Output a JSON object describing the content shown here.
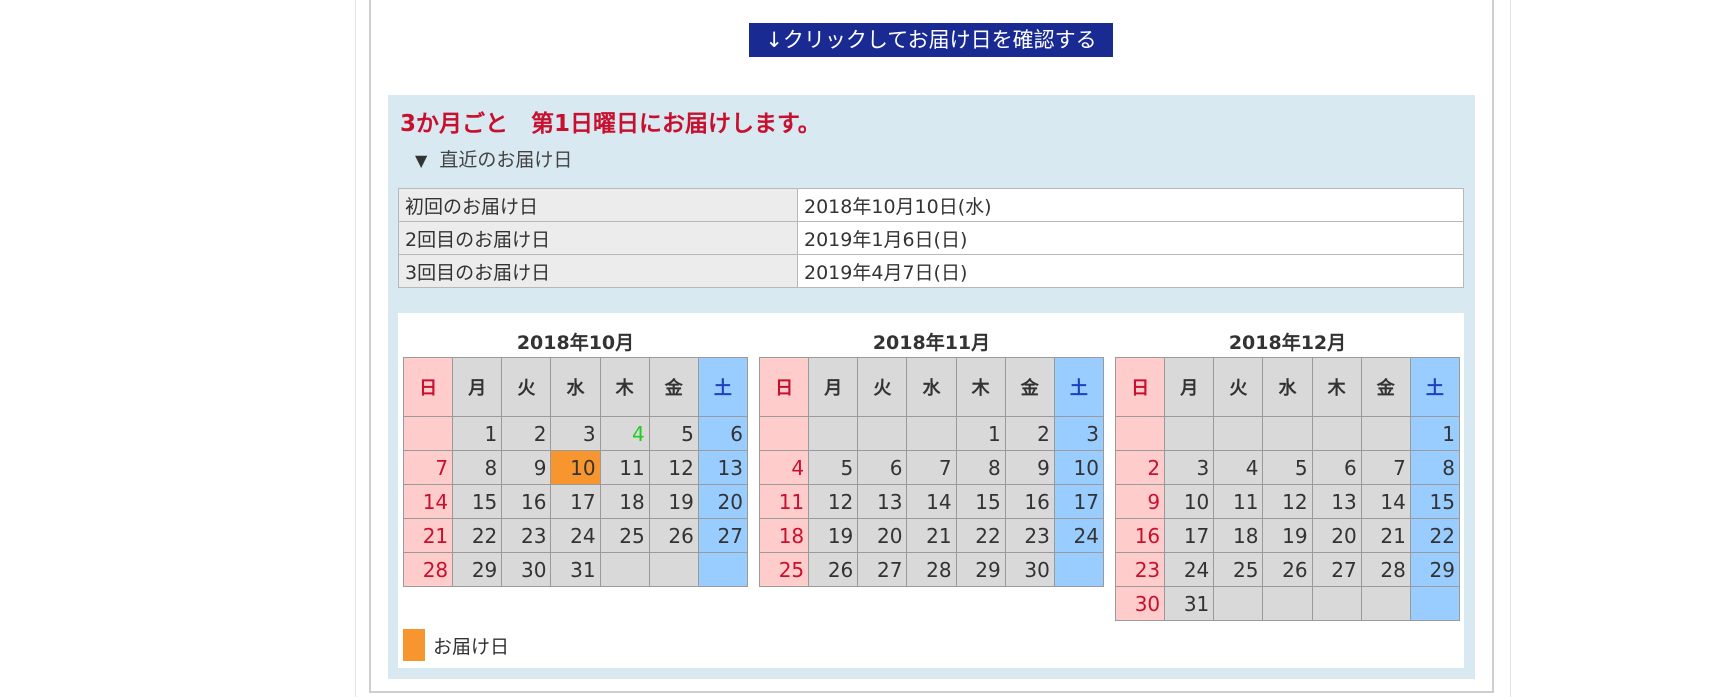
{
  "confirm_button": "↓クリックしてお届け日を確認する",
  "panel": {
    "title": "3か月ごと　第1日曜日にお届けします。",
    "section_toggle_icon": "▼",
    "section_label": "直近のお届け日"
  },
  "deliveries": [
    {
      "label": "初回のお届け日",
      "date": "2018年10月10日(水)"
    },
    {
      "label": "2回目のお届け日",
      "date": "2019年1月6日(日)"
    },
    {
      "label": "3回目のお届け日",
      "date": "2019年4月7日(日)"
    }
  ],
  "weekdays": [
    "日",
    "月",
    "火",
    "水",
    "木",
    "金",
    "土"
  ],
  "calendars": [
    {
      "title": "2018年10月",
      "first_weekday": 1,
      "days": 31,
      "rows": 5,
      "delivery_days": [
        10
      ],
      "green_days": [
        4
      ]
    },
    {
      "title": "2018年11月",
      "first_weekday": 4,
      "days": 30,
      "rows": 5,
      "delivery_days": [],
      "green_days": []
    },
    {
      "title": "2018年12月",
      "first_weekday": 6,
      "days": 31,
      "rows": 6,
      "delivery_days": [],
      "green_days": []
    }
  ],
  "legend": {
    "label": "お届け日",
    "color": "#f7962f"
  },
  "colors": {
    "button_bg": "#1a2a93",
    "title_red": "#c8102e",
    "panel_bg": "#d8e9f2",
    "sunday_bg": "#ffcccc",
    "saturday_bg": "#99ccff",
    "weekday_bg": "#d9d9d9"
  }
}
